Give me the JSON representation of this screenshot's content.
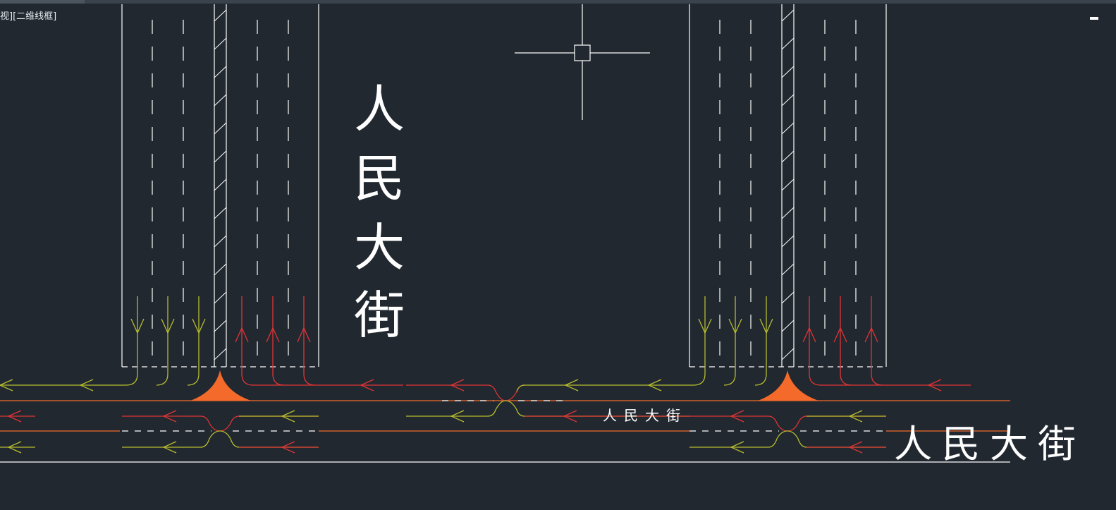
{
  "viewport": {
    "label": "视][二维线框]"
  },
  "drawing": {
    "street_name": "人民大街",
    "street_chars": [
      "人",
      "民",
      "大",
      "街"
    ],
    "colors": {
      "background": "#212830",
      "lines": "#ffffff",
      "road_edge": "#f36a2a",
      "flow_west": "#b7bd2e",
      "flow_east": "#e03535",
      "island": "#f36a2a"
    }
  }
}
